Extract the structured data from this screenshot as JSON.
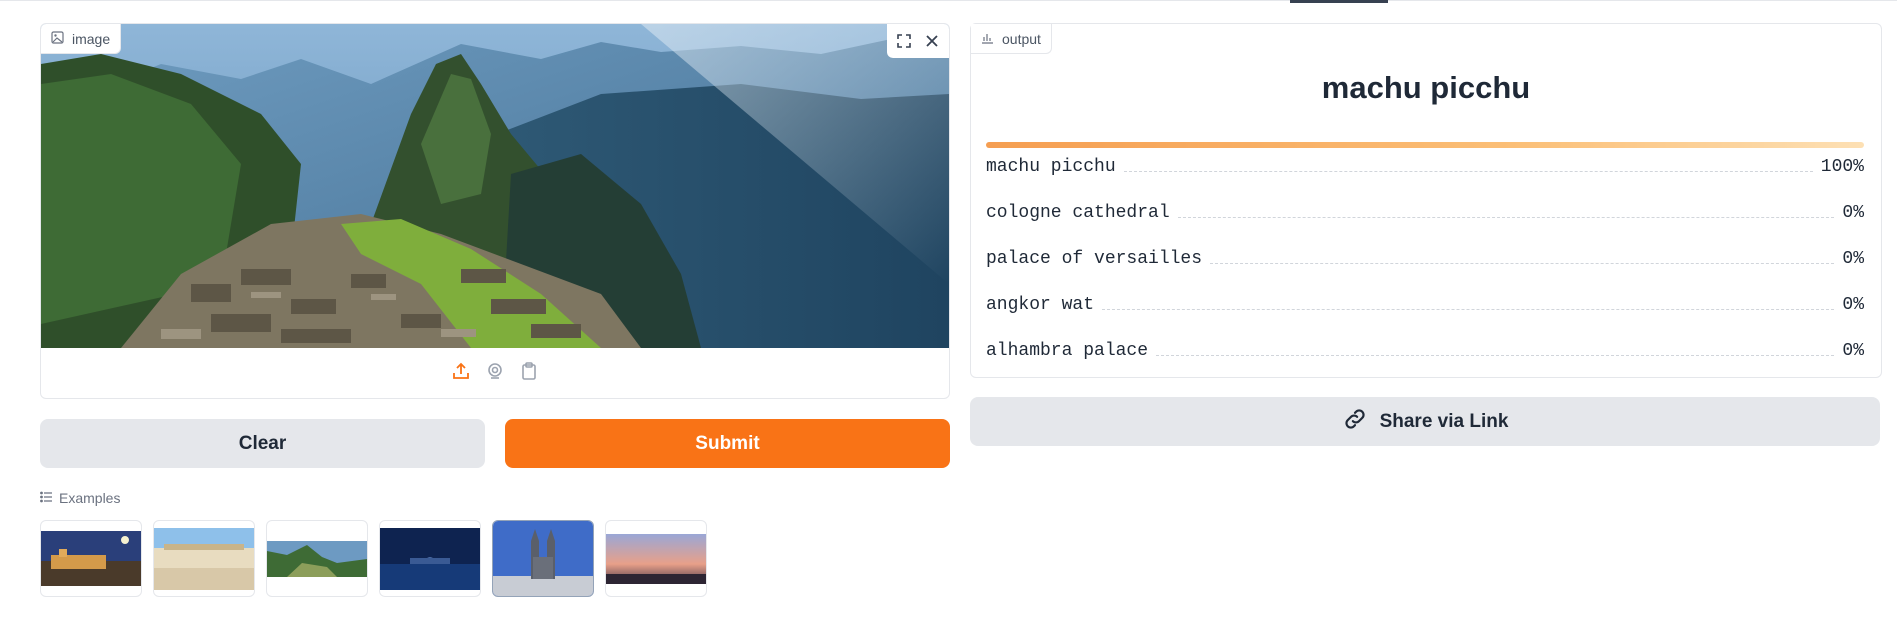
{
  "image_panel": {
    "label": "image",
    "label_icon": "image-icon",
    "fullscreen_icon": "fullscreen-icon",
    "close_icon": "close-icon",
    "source_icons": [
      "upload-icon",
      "webcam-icon",
      "clipboard-icon"
    ],
    "accent": "#f97316"
  },
  "buttons": {
    "clear": "Clear",
    "submit": "Submit",
    "share": "Share via Link"
  },
  "examples": {
    "label": "Examples",
    "label_icon": "list-icon",
    "items": [
      {
        "icon": "alhambra-thumbnail"
      },
      {
        "icon": "versailles-thumbnail"
      },
      {
        "icon": "machu-picchu-thumbnail"
      },
      {
        "icon": "taj-mahal-night-thumbnail"
      },
      {
        "icon": "cologne-cathedral-thumbnail"
      },
      {
        "icon": "angkor-wat-sunset-thumbnail"
      }
    ]
  },
  "output": {
    "label": "output",
    "label_icon": "bar-chart-icon",
    "top_label": "machu picchu",
    "confidences": [
      {
        "label": "machu picchu",
        "value": "100%"
      },
      {
        "label": "cologne cathedral",
        "value": "0%"
      },
      {
        "label": "palace of versailles",
        "value": "0%"
      },
      {
        "label": "angkor wat",
        "value": "0%"
      },
      {
        "label": "alhambra palace",
        "value": "0%"
      }
    ],
    "top_confidence_fraction": 1.0
  }
}
